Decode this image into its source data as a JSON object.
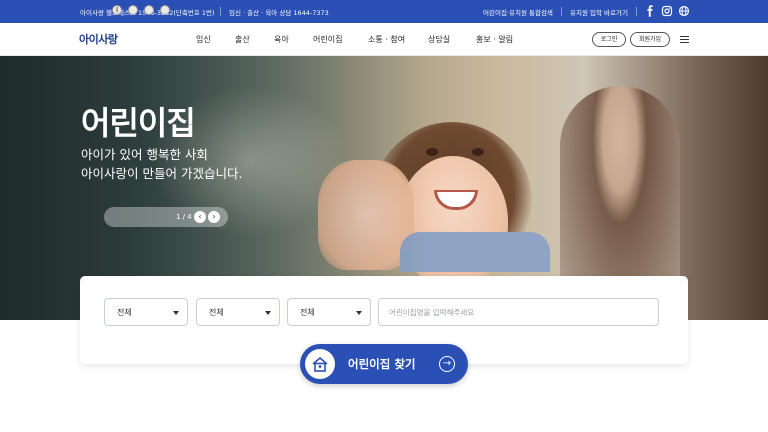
{
  "topbar": {
    "helpdesk": "아이사랑 헬프데스크 1566-3232(단축번호 1번)",
    "consult": "임신 · 출산 · 육아 상담 1644-7373",
    "links": [
      "어린이집·유치원 통합검색",
      "유치원 입학 바로가기"
    ],
    "icons": [
      "facebook-icon",
      "instagram-icon",
      "globe-icon"
    ]
  },
  "nav": {
    "logo": "아이사랑",
    "menu": [
      "임신",
      "출산",
      "육아",
      "어린이집",
      "소통 · 참여",
      "상담실",
      "홍보 · 알림"
    ],
    "login": "로그인",
    "signup": "회원가입"
  },
  "hero": {
    "title": "어린이집",
    "subtitle_line1": "아이가 있어 행복한 사회",
    "subtitle_line2": "아이사랑이 만들어 가겠습니다.",
    "slider_counter": "1 / 4",
    "slides_total": 4,
    "slide_current": 1
  },
  "search": {
    "select1": "전체",
    "select2": "전체",
    "select3": "전체",
    "placeholder": "어린이집명을 입력해주세요",
    "button": "어린이집 찾기"
  },
  "colors": {
    "brand_blue": "#2a4fb5",
    "logo_navy": "#1f3d8f",
    "logo_accent": "#f3a324"
  }
}
